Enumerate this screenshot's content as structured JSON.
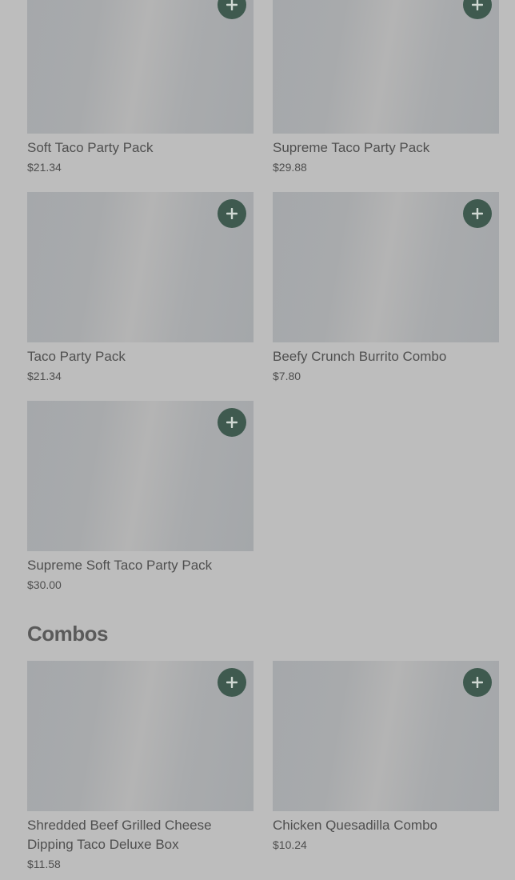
{
  "party_packs": [
    {
      "name": "Soft Taco Party Pack",
      "price": "$21.34"
    },
    {
      "name": "Supreme Taco Party Pack",
      "price": "$29.88"
    },
    {
      "name": "Taco Party Pack",
      "price": "$21.34"
    },
    {
      "name": "Beefy Crunch Burrito Combo",
      "price": "$7.80"
    },
    {
      "name": "Supreme Soft Taco Party Pack",
      "price": "$30.00"
    }
  ],
  "combos_section": {
    "title": "Combos",
    "items": [
      {
        "name": "Shredded Beef Grilled Cheese Dipping Taco Deluxe Box",
        "price": "$11.58"
      },
      {
        "name": "Chicken Quesadilla Combo",
        "price": "$10.24"
      }
    ]
  },
  "icons": {
    "add": "plus-icon"
  },
  "colors": {
    "add_button": "#3f5a4f",
    "overlay": "#bdbdbd"
  }
}
